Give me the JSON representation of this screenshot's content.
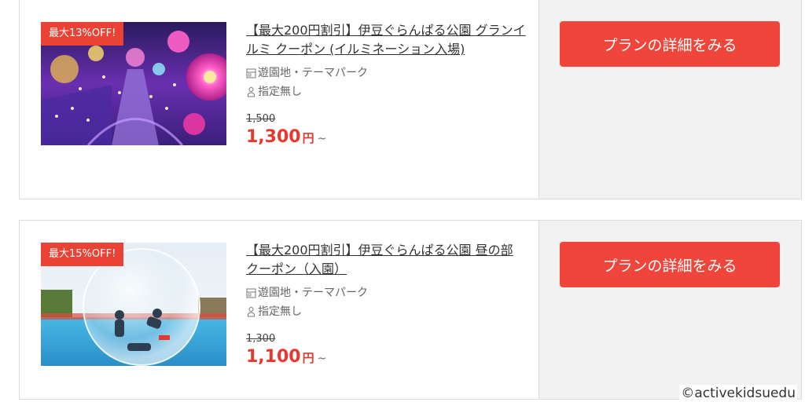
{
  "cards": [
    {
      "badge": "最大13%OFF!",
      "title": "【最大200円割引】伊豆ぐらんぱる公園 グランイルミ クーポン (イルミネーション入場)",
      "category": "遊園地・テーマパーク",
      "target": "指定無し",
      "old_price": "1,500",
      "price": "1,300",
      "currency": "円",
      "suffix": "~",
      "cta_label": "プランの詳細をみる",
      "image_icon": "illumination-photo"
    },
    {
      "badge": "最大15%OFF!",
      "title": "【最大200円割引】伊豆ぐらんぱる公園 昼の部 クーポン（入園）",
      "category": "遊園地・テーマパーク",
      "target": "指定無し",
      "old_price": "1,300",
      "price": "1,100",
      "currency": "円",
      "suffix": "~",
      "cta_label": "プランの詳細をみる",
      "image_icon": "water-ball-photo"
    }
  ],
  "copyright": "©activekidsuedu",
  "colors": {
    "accent": "#ea4335",
    "price": "#e8382d",
    "sidebar_bg": "#f2f2f2"
  }
}
